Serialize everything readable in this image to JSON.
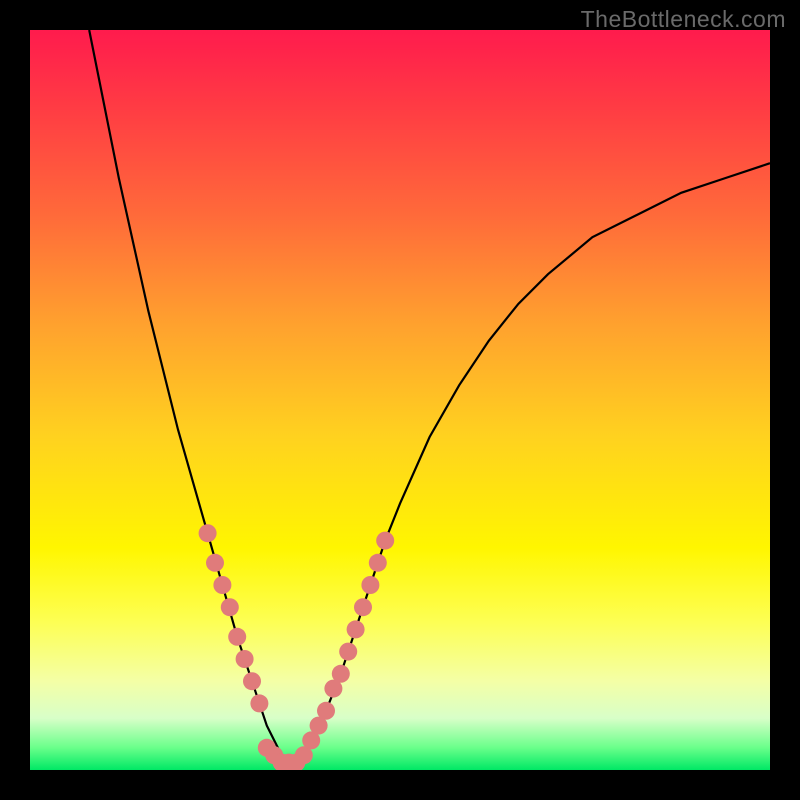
{
  "watermark": "TheBottleneck.com",
  "colors": {
    "background": "#000000",
    "gradient_top": "#ff1b4d",
    "gradient_bottom": "#00e865",
    "curve": "#000000",
    "dots": "#e07b7b"
  },
  "chart_data": {
    "type": "line",
    "title": "",
    "xlabel": "",
    "ylabel": "",
    "xlim": [
      0,
      100
    ],
    "ylim": [
      0,
      100
    ],
    "x": [
      8,
      10,
      12,
      14,
      16,
      18,
      20,
      22,
      24,
      26,
      28,
      30,
      32,
      33,
      34,
      35,
      36,
      37,
      38,
      40,
      42,
      44,
      46,
      48,
      50,
      54,
      58,
      62,
      66,
      70,
      76,
      82,
      88,
      94,
      100
    ],
    "y": [
      100,
      90,
      80,
      71,
      62,
      54,
      46,
      39,
      32,
      25,
      18,
      12,
      6,
      4,
      2,
      1,
      1,
      2,
      4,
      8,
      13,
      19,
      25,
      31,
      36,
      45,
      52,
      58,
      63,
      67,
      72,
      75,
      78,
      80,
      82
    ],
    "dots_left": [
      {
        "x": 24,
        "y": 32
      },
      {
        "x": 25,
        "y": 28
      },
      {
        "x": 26,
        "y": 25
      },
      {
        "x": 27,
        "y": 22
      },
      {
        "x": 28,
        "y": 18
      },
      {
        "x": 29,
        "y": 15
      },
      {
        "x": 30,
        "y": 12
      },
      {
        "x": 31,
        "y": 9
      }
    ],
    "dots_right": [
      {
        "x": 38,
        "y": 4
      },
      {
        "x": 39,
        "y": 6
      },
      {
        "x": 40,
        "y": 8
      },
      {
        "x": 41,
        "y": 11
      },
      {
        "x": 42,
        "y": 13
      },
      {
        "x": 43,
        "y": 16
      },
      {
        "x": 44,
        "y": 19
      },
      {
        "x": 45,
        "y": 22
      },
      {
        "x": 46,
        "y": 25
      },
      {
        "x": 47,
        "y": 28
      },
      {
        "x": 48,
        "y": 31
      }
    ],
    "dots_bottom": [
      {
        "x": 32,
        "y": 3
      },
      {
        "x": 33,
        "y": 2
      },
      {
        "x": 34,
        "y": 1
      },
      {
        "x": 35,
        "y": 1
      },
      {
        "x": 36,
        "y": 1
      },
      {
        "x": 37,
        "y": 2
      }
    ]
  }
}
